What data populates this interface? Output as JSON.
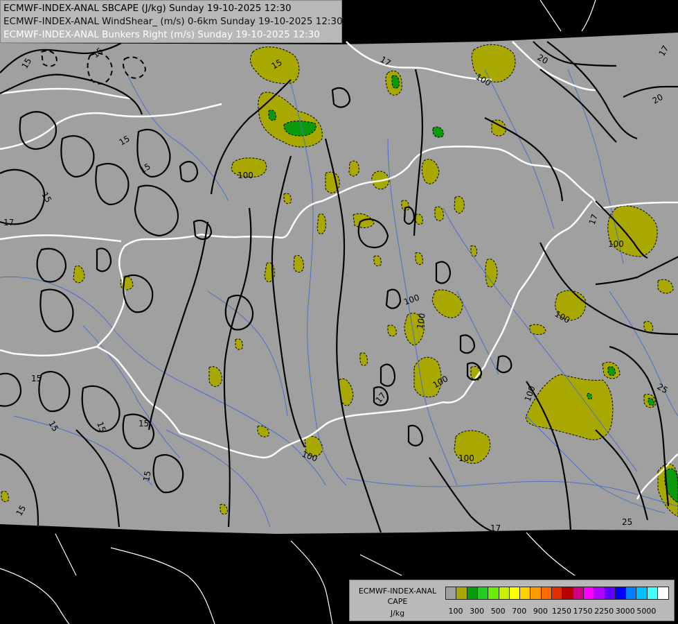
{
  "header": {
    "lines": [
      "ECMWF-INDEX-ANAL SBCAPE (J/kg) Sunday 19-10-2025 12:30",
      "ECMWF-INDEX-ANAL WindShear_ (m/s) 0-6km Sunday 19-10-2025 12:30",
      "ECMWF-INDEX-ANAL Bunkers Right (m/s) Sunday 19-10-2025 12:30"
    ]
  },
  "legend": {
    "title_lines": [
      "ECMWF-INDEX-ANAL",
      "CAPE",
      "J/kg"
    ],
    "colors": [
      "#a0a0a0",
      "#a8a800",
      "#0a9b0a",
      "#22cc22",
      "#66ee00",
      "#c8f000",
      "#ffff00",
      "#ffd000",
      "#ff9a00",
      "#ff6a00",
      "#e03000",
      "#b80000",
      "#d00080",
      "#ff00ff",
      "#b000ff",
      "#6000ff",
      "#0000ff",
      "#0080ff",
      "#00c0ff",
      "#40ffff",
      "#ffffff"
    ],
    "tick_labels": [
      "100",
      "300",
      "500",
      "700",
      "900",
      "1250",
      "1750",
      "2250",
      "3000",
      "5000"
    ]
  },
  "map_colors": {
    "background": "#000000",
    "domain": "#a0a0a0",
    "cape_100": "#a8a800",
    "cape_300": "#0a9b0a",
    "cape_500": "#22cc22",
    "border": "#ffffff",
    "river": "#4a70c8",
    "contour": "#000000"
  },
  "contour_labels": [
    "15",
    "17",
    "20",
    "25",
    "100"
  ]
}
